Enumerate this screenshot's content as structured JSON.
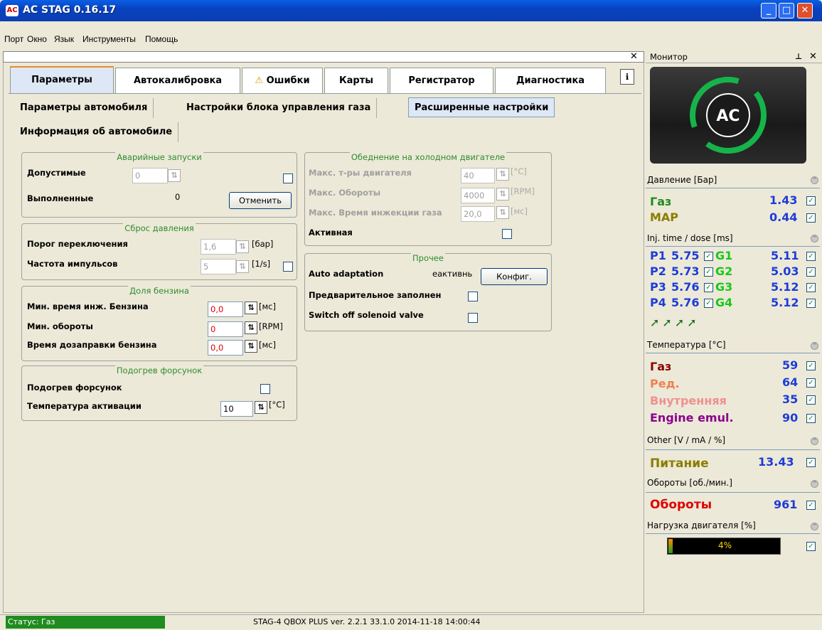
{
  "window": {
    "title": "AC STAG 0.16.17",
    "logo": "AC"
  },
  "menu": [
    "Порт",
    "Окно",
    "Язык",
    "Инструменты",
    "Помощь"
  ],
  "main_tabs": [
    {
      "label": "Параметры",
      "active": true
    },
    {
      "label": "Автокалибровка"
    },
    {
      "label": "Ошибки",
      "icon": "warning-icon"
    },
    {
      "label": "Карты"
    },
    {
      "label": "Регистратор"
    },
    {
      "label": "Диагностика"
    }
  ],
  "sub_tabs": [
    {
      "label": "Параметры автомобиля"
    },
    {
      "label": "Настройки блока управления газа"
    },
    {
      "label": "Расширенные настройки",
      "active": true
    },
    {
      "label": "Информация об автомобиле"
    }
  ],
  "emergency": {
    "title": "Аварийные запуски",
    "allowed_label": "Допустимые",
    "allowed_value": "0",
    "done_label": "Выполненные",
    "done_value": "0",
    "cancel_button": "Отменить"
  },
  "pressure_reset": {
    "title": "Сброс давления",
    "threshold_label": "Порог переключения",
    "threshold_value": "1,6",
    "threshold_unit": "[бар]",
    "freq_label": "Частота импульсов",
    "freq_value": "5",
    "freq_unit": "[1/s]"
  },
  "petrol_share": {
    "title": "Доля бензина",
    "min_inj_label": "Мин. время инж. Бензина",
    "min_inj_value": "0,0",
    "min_inj_unit": "[мс]",
    "min_rpm_label": "Мин. обороты",
    "min_rpm_value": "0",
    "min_rpm_unit": "[RPM]",
    "refuel_label": "Время дозаправки бензина",
    "refuel_value": "0,0",
    "refuel_unit": "[мс]"
  },
  "injector_heat": {
    "title": "Подогрев форсунок",
    "heat_label": "Подогрев форсунок",
    "temp_label": "Температура активации",
    "temp_value": "10",
    "temp_unit": "[°C]"
  },
  "cold_lean": {
    "title": "Обеднение на холодном двигателе",
    "max_temp_label": "Макс. т-ры двигателя",
    "max_temp_value": "40",
    "max_temp_unit": "[°C]",
    "max_rpm_label": "Макс. Обороты",
    "max_rpm_value": "4000",
    "max_rpm_unit": "[RPM]",
    "max_inj_label": "Макс. Время инжекции газа",
    "max_inj_value": "20,0",
    "max_inj_unit": "[мс]",
    "active_label": "Активная"
  },
  "other": {
    "title": "Прочее",
    "auto_adapt_label": "Auto adaptation",
    "auto_adapt_value": "еактивнь",
    "config_button": "Конфиг.",
    "prefill_label": "Предварительное заполнен",
    "switch_off_label": "Switch off solenoid valve"
  },
  "status": {
    "left": "Статус: Газ",
    "center": "STAG-4 QBOX PLUS  ver. 2.2.1  33.1.0  2014-11-18 14:00:44"
  },
  "monitor": {
    "title": "Монитор",
    "pressure": {
      "header": "Давление [Бар]",
      "gas_label": "Газ",
      "gas_value": "1.43",
      "map_label": "MAP",
      "map_value": "0.44"
    },
    "inj": {
      "header": "Inj. time / dose [ms]",
      "rows": [
        {
          "p": "P1",
          "pv": "5.75",
          "g": "G1",
          "gv": "5.11"
        },
        {
          "p": "P2",
          "pv": "5.73",
          "g": "G2",
          "gv": "5.03"
        },
        {
          "p": "P3",
          "pv": "5.76",
          "g": "G3",
          "gv": "5.12"
        },
        {
          "p": "P4",
          "pv": "5.76",
          "g": "G4",
          "gv": "5.12"
        }
      ]
    },
    "temp": {
      "header": "Температура [°C]",
      "gas_label": "Газ",
      "gas_value": "59",
      "red_label": "Ред.",
      "red_value": "64",
      "int_label": "Внутренняя",
      "int_value": "35",
      "emu_label": "Engine emul.",
      "emu_value": "90"
    },
    "other": {
      "header": "Other [V / mA / %]",
      "power_label": "Питание",
      "power_value": "13.43"
    },
    "rpm": {
      "header": "Обороты [об./мин.]",
      "label": "Обороты",
      "value": "961"
    },
    "load": {
      "header": "Нагрузка двигателя [%]",
      "value": "4%",
      "fraction": 0.04
    }
  },
  "colors": {
    "p_blue": "#1e3cd7",
    "g_green": "#18c818",
    "gas_red": "#8b0000",
    "map_olive": "#8b7d00"
  }
}
